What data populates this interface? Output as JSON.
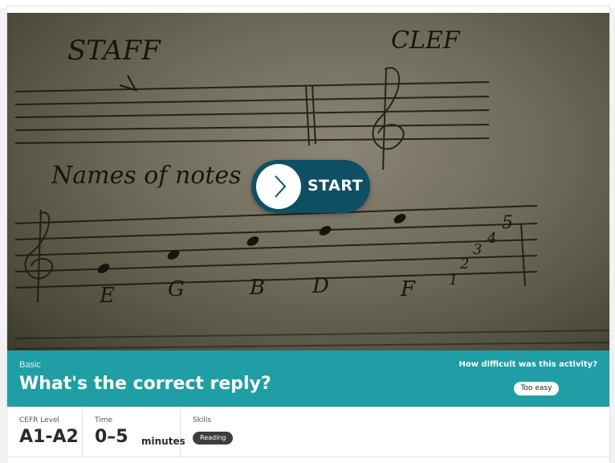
{
  "hero": {
    "start_label": "START",
    "play_icon": "chevron-right-icon",
    "photo_text": {
      "staff": "STAFF",
      "clef": "CLEF",
      "names": "Names of notes",
      "notes": [
        "E",
        "G",
        "B",
        "D",
        "F"
      ],
      "numbers": [
        "1",
        "2",
        "3",
        "4",
        "5"
      ]
    }
  },
  "activity": {
    "level": "Basic",
    "title": "What's the correct reply?",
    "difficulty_prompt": "How difficult was this activity?",
    "difficulty_option": "Too easy"
  },
  "meta": {
    "cefr_caption": "CEFR Level",
    "cefr_value": "A1-A2",
    "time_caption": "Time",
    "time_value": "0–5",
    "time_unit": "minutes",
    "skills_caption": "Skills",
    "skills": [
      "Reading"
    ]
  },
  "colors": {
    "accent": "#1f9fa5",
    "start_button": "#0e4f63",
    "pill_dark": "#3d3d3d"
  }
}
